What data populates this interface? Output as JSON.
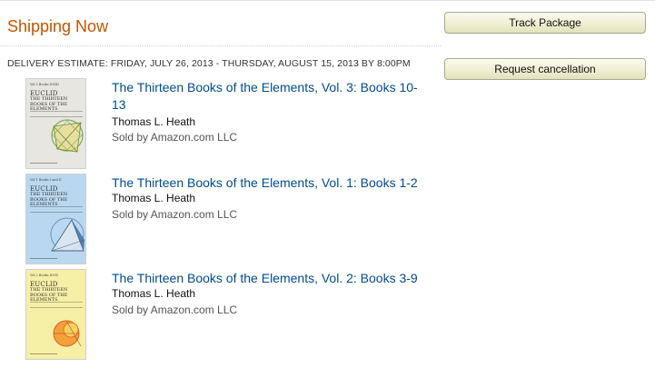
{
  "shipment": {
    "status": "Shipping Now",
    "delivery_estimate": "DELIVERY ESTIMATE: FRIDAY, JULY 26, 2013 - THURSDAY, AUGUST 15, 2013 BY 8:00PM"
  },
  "actions": {
    "track_label": "Track Package",
    "cancel_label": "Request cancellation"
  },
  "items": [
    {
      "title": "The Thirteen Books of the Elements, Vol. 3: Books 10-13",
      "author": "Thomas L. Heath",
      "seller": "Sold by Amazon.com LLC",
      "cover": {
        "top": "Vol 3 Books X-XIII",
        "author": "EUCLID",
        "title": "THE THIRTEEN BOOKS OF THE ELEMENTS",
        "color": "#e7e6e1"
      }
    },
    {
      "title": "The Thirteen Books of the Elements, Vol. 1: Books 1-2",
      "author": "Thomas L. Heath",
      "seller": "Sold by Amazon.com LLC",
      "cover": {
        "top": "Vol 1 Books I and II",
        "author": "EUCLID",
        "title": "THE THIRTEEN BOOKS OF THE ELEMENTS",
        "color": "#b9d8ef"
      }
    },
    {
      "title": "The Thirteen Books of the Elements, Vol. 2: Books 3-9",
      "author": "Thomas L. Heath",
      "seller": "Sold by Amazon.com LLC",
      "cover": {
        "top": "Vol 2 Books III-IX",
        "author": "EUCLID",
        "title": "THE THIRTEEN BOOKS OF THE ELEMENTS",
        "color": "#f6efa6"
      }
    }
  ]
}
